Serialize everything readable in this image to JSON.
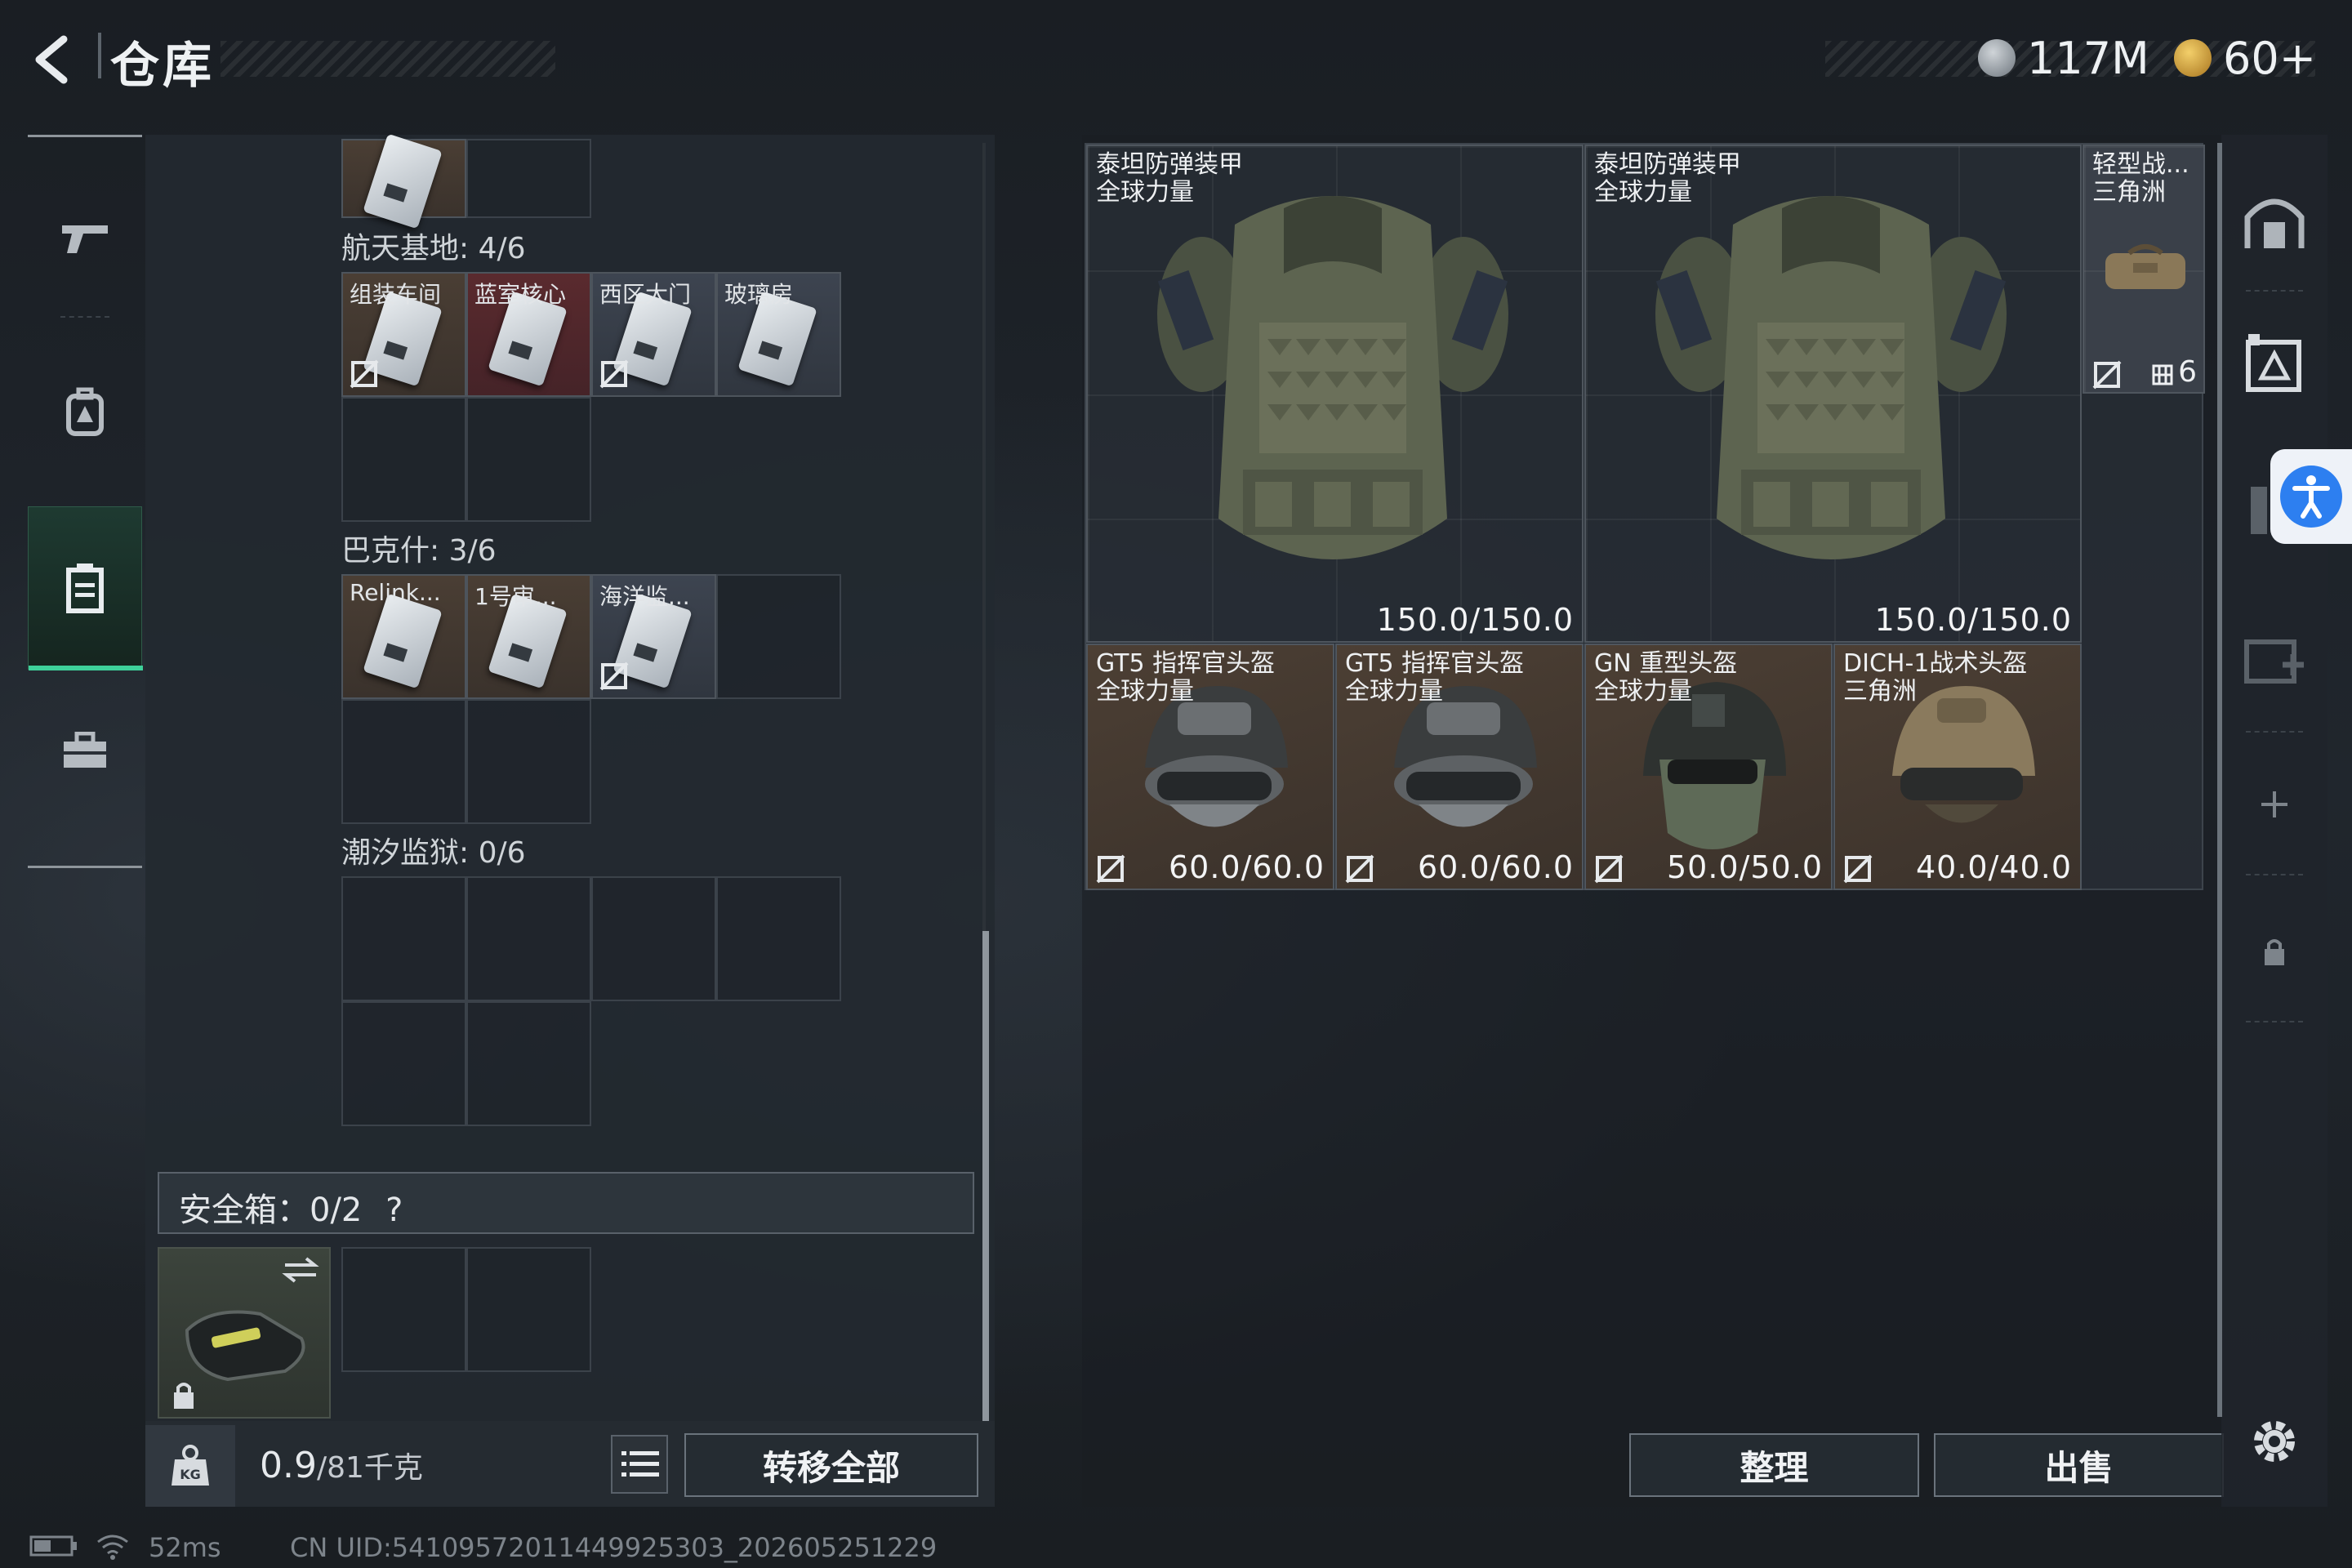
{
  "header": {
    "title": "仓库",
    "currency1": "117M",
    "currency2": "60+"
  },
  "nav": {
    "items": [
      "weapons-icon",
      "backpack-icon",
      "container-icon",
      "toolbox-icon"
    ],
    "active": 2
  },
  "left": {
    "sections": [
      {
        "label": "航天基地: 4/6",
        "cards": [
          "组装车间",
          "蓝室核心",
          "西区大门",
          "玻璃房"
        ]
      },
      {
        "label": "巴克什: 3/6",
        "cards": [
          "Relink...",
          "1号审...",
          "海洋监..."
        ]
      },
      {
        "label": "潮汐监狱: 0/6",
        "cards": []
      }
    ],
    "safe_label": "安全箱：0/2",
    "safe_help": "?",
    "weight_value": "0.9",
    "weight_max": "/81千克",
    "kg_label": "KG",
    "transfer_all": "转移全部"
  },
  "stash": {
    "vests": [
      {
        "name": "泰坦防弹装甲",
        "tag": "全球力量",
        "durability": "150.0/150.0"
      },
      {
        "name": "泰坦防弹装甲",
        "tag": "全球力量",
        "durability": "150.0/150.0"
      }
    ],
    "bag": {
      "name": "轻型战...",
      "tag": "三角洲",
      "count": "6"
    },
    "helmets": [
      {
        "name": "GT5 指挥官头盔",
        "tag": "全球力量",
        "durability": "60.0/60.0"
      },
      {
        "name": "GT5 指挥官头盔",
        "tag": "全球力量",
        "durability": "60.0/60.0"
      },
      {
        "name": "GN 重型头盔",
        "tag": "全球力量",
        "durability": "50.0/50.0"
      },
      {
        "name": "DICH-1战术头盔",
        "tag": "三角洲",
        "durability": "40.0/40.0"
      }
    ],
    "sort_button": "整理",
    "sell_button": "出售"
  },
  "status": {
    "ping": "52ms",
    "uid": "CN UID:5410957201144992530​3_202605251229"
  },
  "colors": {
    "accent": "#3ed09a",
    "red_rarity": "#5b2a31",
    "gold_rarity": "#4c3f34",
    "access": "#2d7ff0"
  }
}
